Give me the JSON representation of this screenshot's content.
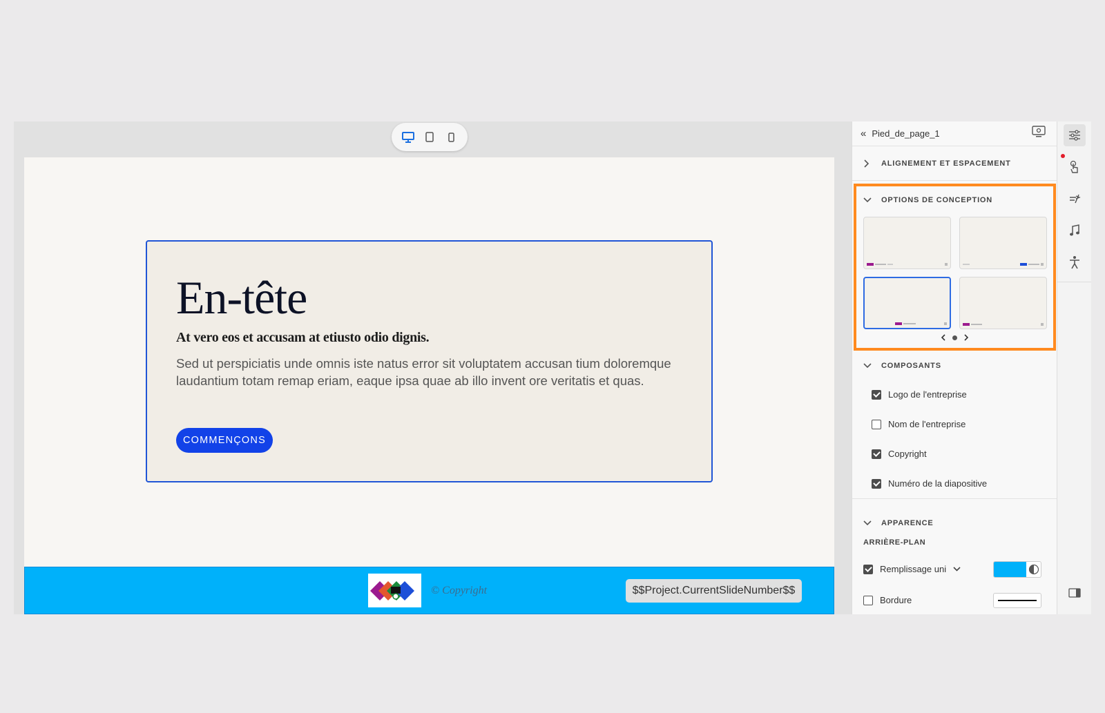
{
  "device_modes": [
    "desktop",
    "tablet",
    "mobile"
  ],
  "slide": {
    "title": "En-tête",
    "subtitle": "At vero eos et accusam at etiusto odio dignis.",
    "body": "Sed ut perspiciatis unde omnis iste natus error sit voluptatem accusan tium doloremque laudantium totam remap eriam, eaque ipsa quae ab illo invent ore veritatis et quas.",
    "cta_label": "COMMENÇONS",
    "footer": {
      "copyright": "© Copyright",
      "slide_number": "$$Project.CurrentSlideNumber$$",
      "background": "#00b1fa"
    }
  },
  "panel": {
    "title": "Pied_de_page_1",
    "sections": {
      "alignment": "ALIGNEMENT ET ESPACEMENT",
      "design_options": "OPTIONS DE CONCEPTION",
      "components": "COMPOSANTS",
      "appearance": "APPARENCE"
    },
    "components": [
      {
        "label": "Logo de l'entreprise",
        "checked": true
      },
      {
        "label": "Nom de l'entreprise",
        "checked": false
      },
      {
        "label": "Copyright",
        "checked": true
      },
      {
        "label": "Numéro de la diapositive",
        "checked": true
      }
    ],
    "appearance": {
      "background_label": "ARRIÈRE-PLAN",
      "fill_label": "Remplissage uni",
      "border_label": "Bordure",
      "fill_color": "#00b1fa"
    },
    "selected_design": 2
  },
  "colors": {
    "accent": "#2055d6",
    "cta": "#1242e8",
    "highlight": "#ff8a1f"
  }
}
